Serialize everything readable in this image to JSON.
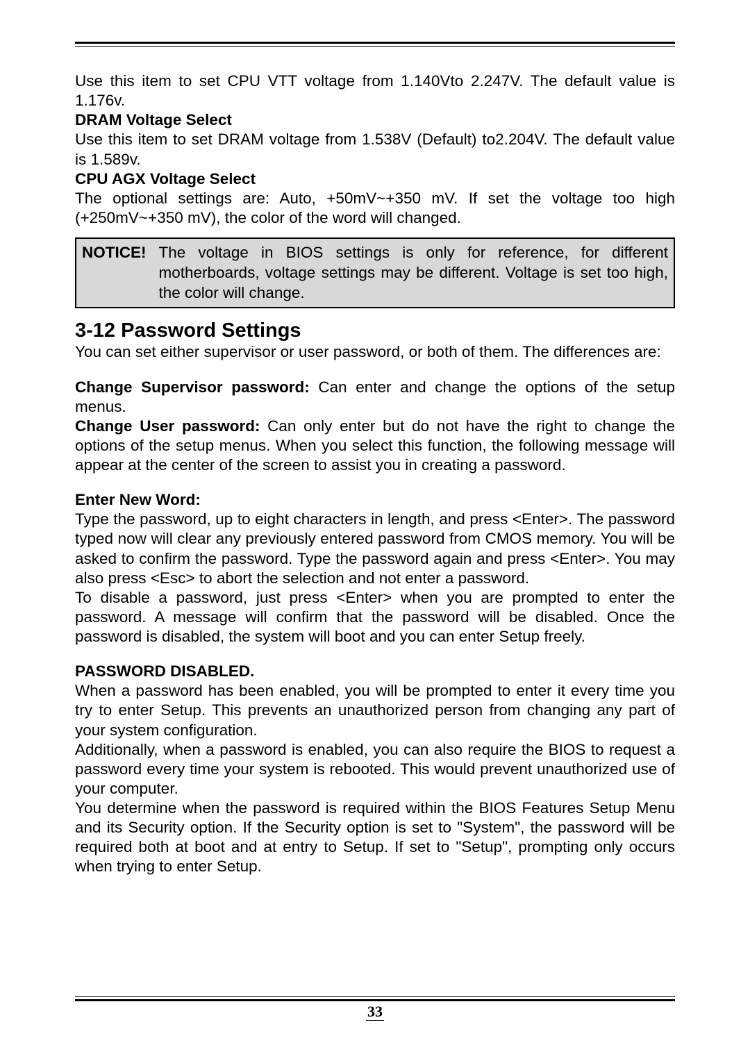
{
  "intro": {
    "cpu_vtt": "Use this item to set CPU VTT voltage from 1.140Vto 2.247V. The default value is 1.176v.",
    "dram_heading": "DRAM Voltage Select",
    "dram_text": "Use this item to set DRAM voltage from 1.538V (Default) to2.204V. The default value is 1.589v.",
    "agx_heading": "CPU AGX Voltage Select",
    "agx_text": "The optional settings are: Auto, +50mV~+350 mV. If set the voltage too high (+250mV~+350 mV), the color of the word will changed."
  },
  "notice": {
    "label": "NOTICE!",
    "text": "The voltage in BIOS settings is only for reference, for different motherboards, voltage settings may be different. Voltage is set too high, the color will change."
  },
  "section": {
    "title": "3-12 Password Settings",
    "intro": "You can set either supervisor or user password, or both of them. The differences are:",
    "change_sup_label": "Change Supervisor password:",
    "change_sup_text": " Can enter and change the options of the setup menus",
    "change_user_label": "Change User password:",
    "change_user_text": "   Can only enter but do not have the right to change the options of the setup menus. When you select this function, the following message will appear at the center of the screen to assist you in creating a password.",
    "enter_new_word": "Enter New Word:",
    "enter_new_text": "Type the password, up to eight characters in length, and press <Enter>. The password typed now will clear any previously entered password from CMOS memory. You will be asked to confirm the password. Type the password again and press <Enter>. You may also press <Esc> to abort the selection and not enter a password.\nTo disable a password, just press <Enter> when you are prompted to enter the password. A message will confirm that the password will be disabled. Once the password is disabled, the system will boot and you can enter Setup freely.",
    "pwd_disabled_heading": "PASSWORD DISABLED.",
    "pwd_disabled_text": "When a password has been enabled, you will be prompted to enter it every time you try to enter Setup. This prevents an unauthorized person from changing any part of your system configuration.\nAdditionally, when a password is enabled, you can also require the BIOS to request a password every time your system is rebooted. This would prevent unauthorized use of your computer.\nYou determine when the password is required within the BIOS Features Setup Menu and its Security option. If the Security option is set to \"System\", the password will be required both at boot and at entry to Setup. If set to \"Setup\", prompting only occurs when trying to enter Setup."
  },
  "page_number": "33"
}
